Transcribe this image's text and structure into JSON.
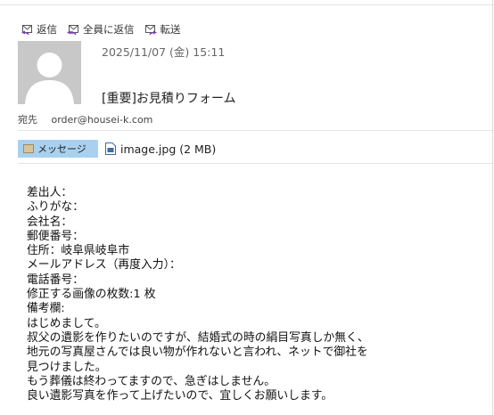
{
  "toolbar": {
    "reply_label": "返信",
    "reply_all_label": "全員に返信",
    "forward_label": "転送"
  },
  "header": {
    "date": "2025/11/07 (金) 15:11",
    "subject": "[重要]お見積りフォーム",
    "to_label": "宛先",
    "to_address": "order@housei-k.com"
  },
  "attachments": {
    "message_tab": "メッセージ",
    "file": "image.jpg (2 MB)"
  },
  "body_lines": [
    "差出人：",
    "ふりがな：",
    "会社名：",
    "郵便番号：",
    "住所：岐阜県岐阜市",
    "メールアドレス（再度入力）：",
    "電話番号：",
    "修正する画像の枚数:1 枚",
    "備考欄:",
    "はじめまして。",
    "叔父の遺影を作りたいのですが、結婚式の時の絹目写真しか無く、",
    "地元の写真屋さんでは良い物が作れないと言われ、ネットで御社を",
    "見つけました。",
    "もう葬儀は終わってますので、急ぎはしません。",
    "良い遺影写真を作って上げたいので、宜しくお願いします。"
  ],
  "colors": {
    "message_tab": "#a9d1ef",
    "avatar_bg": "#c8c8c8",
    "icon_accent": "#7a3fb0"
  }
}
